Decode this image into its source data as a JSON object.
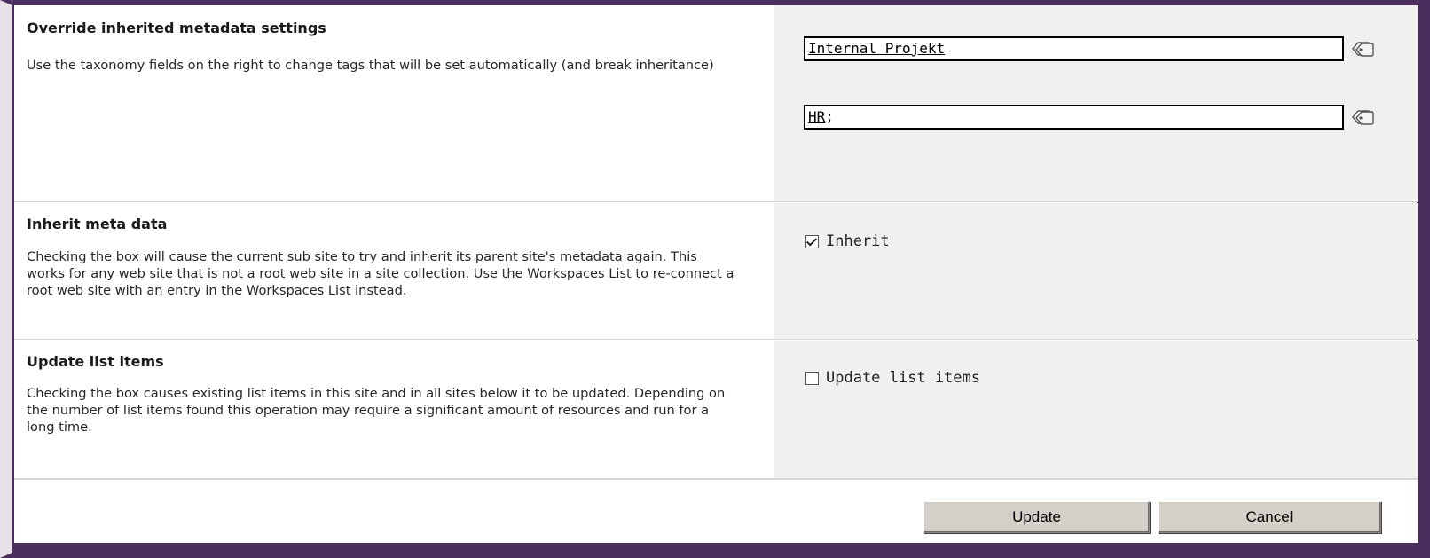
{
  "sections": [
    {
      "heading": "Override inherited metadata settings",
      "description": "Use the taxonomy fields on the right to change tags that will be set automatically (and break inheritance)",
      "fields": [
        {
          "term": "Internal Projekt",
          "suffix": ""
        },
        {
          "term": "HR",
          "suffix": ";"
        }
      ],
      "tag_icon": "tags-icon"
    },
    {
      "heading": "Inherit meta data",
      "description": "Checking the box will cause the current sub site to try and inherit its parent site's metadata again. This works for any web site that is not a root web site in a site collection. Use the Workspaces List to re-connect a root web site with an entry in the Workspaces List instead.",
      "checkbox": {
        "label": "Inherit",
        "checked": true
      }
    },
    {
      "heading": "Update list items",
      "description": "Checking the box causes existing list items in this site and in all sites below it to be updated. Depending on the number of list items found this operation may require a significant amount of resources and run for a long time.",
      "checkbox": {
        "label": "Update list items",
        "checked": false
      }
    }
  ],
  "buttons": {
    "update": "Update",
    "cancel": "Cancel"
  },
  "colors": {
    "frame": "#4b2d5e",
    "right_panel": "#f0f0f0",
    "button_face": "#d4d0c8"
  }
}
